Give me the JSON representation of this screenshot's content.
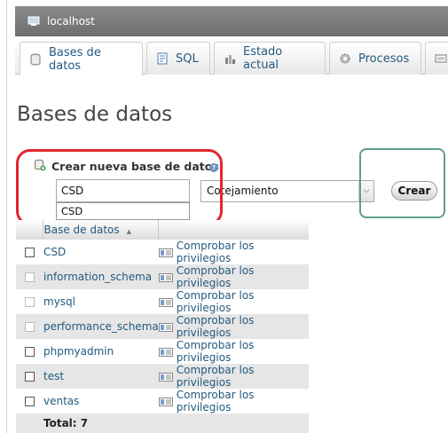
{
  "window": {
    "title": "localhost"
  },
  "tabs": [
    {
      "label": "Bases de datos",
      "icon": "database-icon",
      "active": true
    },
    {
      "label": "SQL",
      "icon": "sql-icon"
    },
    {
      "label": "Estado actual",
      "icon": "status-icon"
    },
    {
      "label": "Procesos",
      "icon": "gear-icon"
    }
  ],
  "page": {
    "title": "Bases de datos"
  },
  "create": {
    "label": "Crear nueva base de datos",
    "input_value": "CSD",
    "autocomplete": "CSD",
    "collation": "Cotejamiento",
    "button": "Crear"
  },
  "table": {
    "column_header": "Base de datos",
    "privileges_label": "Comprobar los privilegios",
    "rows": [
      {
        "name": "CSD",
        "checkbox_enabled": true
      },
      {
        "name": "information_schema",
        "checkbox_enabled": false
      },
      {
        "name": "mysql",
        "checkbox_enabled": false
      },
      {
        "name": "performance_schema",
        "checkbox_enabled": false
      },
      {
        "name": "phpmyadmin",
        "checkbox_enabled": true
      },
      {
        "name": "test",
        "checkbox_enabled": true
      },
      {
        "name": "ventas",
        "checkbox_enabled": true
      }
    ],
    "total": "Total: 7"
  },
  "colors": {
    "link": "#235a81",
    "highlight_red": "#e3262d",
    "highlight_green": "#5fa08b"
  }
}
